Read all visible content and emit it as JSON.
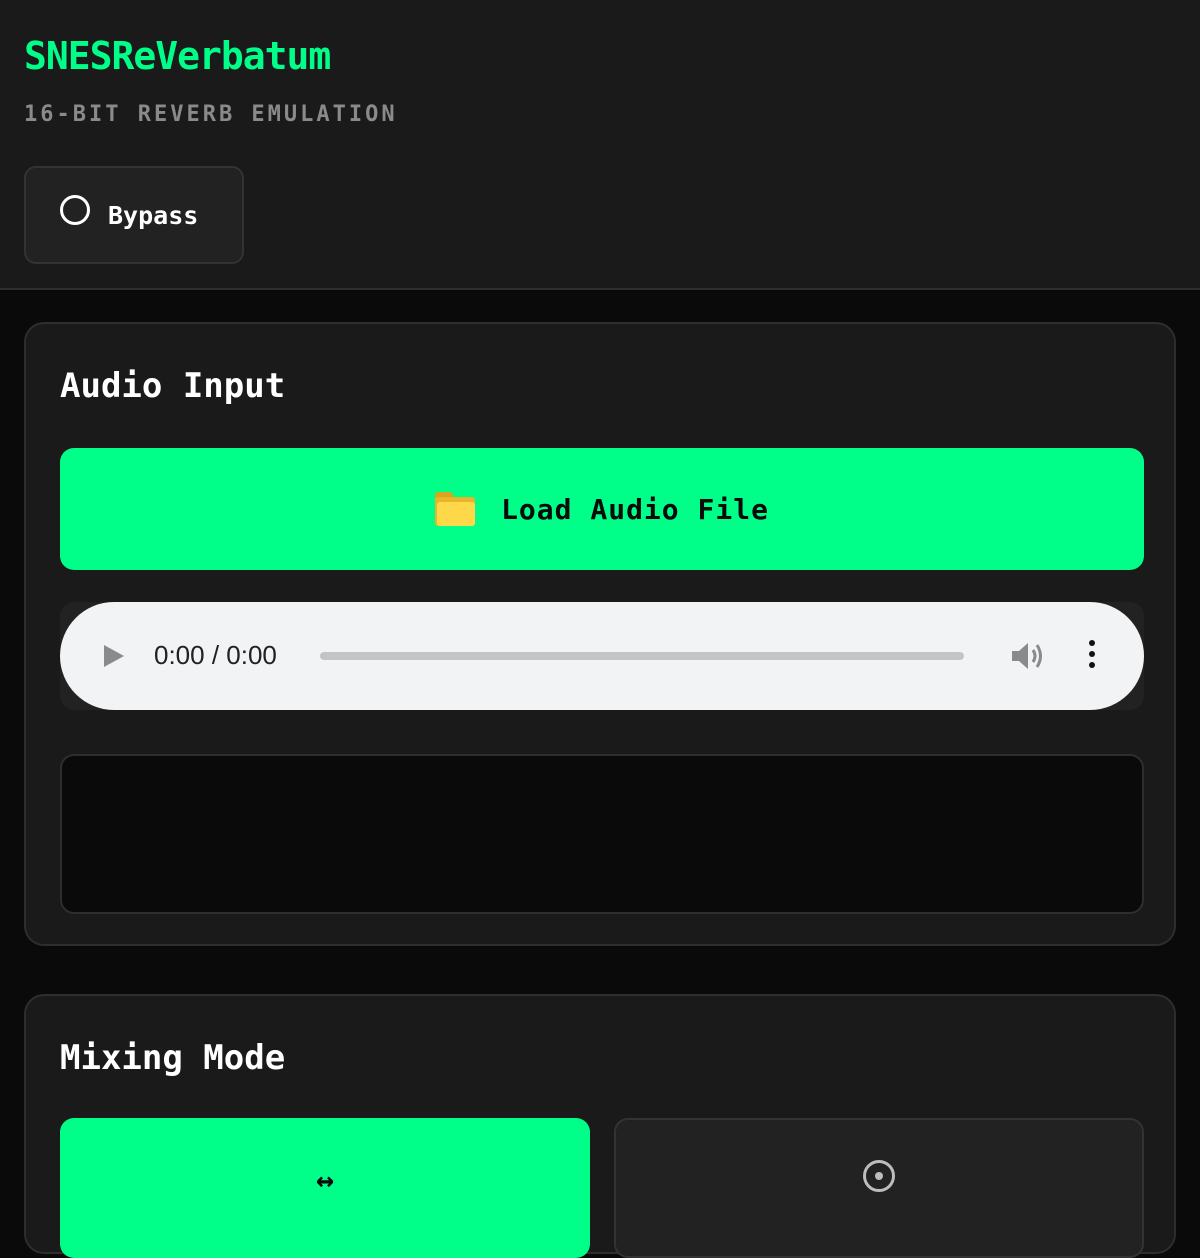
{
  "header": {
    "title": "SNESReVerbatum",
    "subtitle": "16-BIT REVERB EMULATION",
    "bypass_label": "Bypass"
  },
  "audio_input": {
    "title": "Audio Input",
    "load_label": "Load Audio File",
    "player": {
      "time": "0:00 / 0:00"
    }
  },
  "mixing_mode": {
    "title": "Mixing Mode",
    "options": [
      {
        "icon": "↔",
        "active": true
      },
      {
        "icon": "⊙",
        "active": false
      }
    ]
  },
  "colors": {
    "accent": "#00ff88",
    "background": "#0a0a0a",
    "panel": "#1a1a1a"
  }
}
